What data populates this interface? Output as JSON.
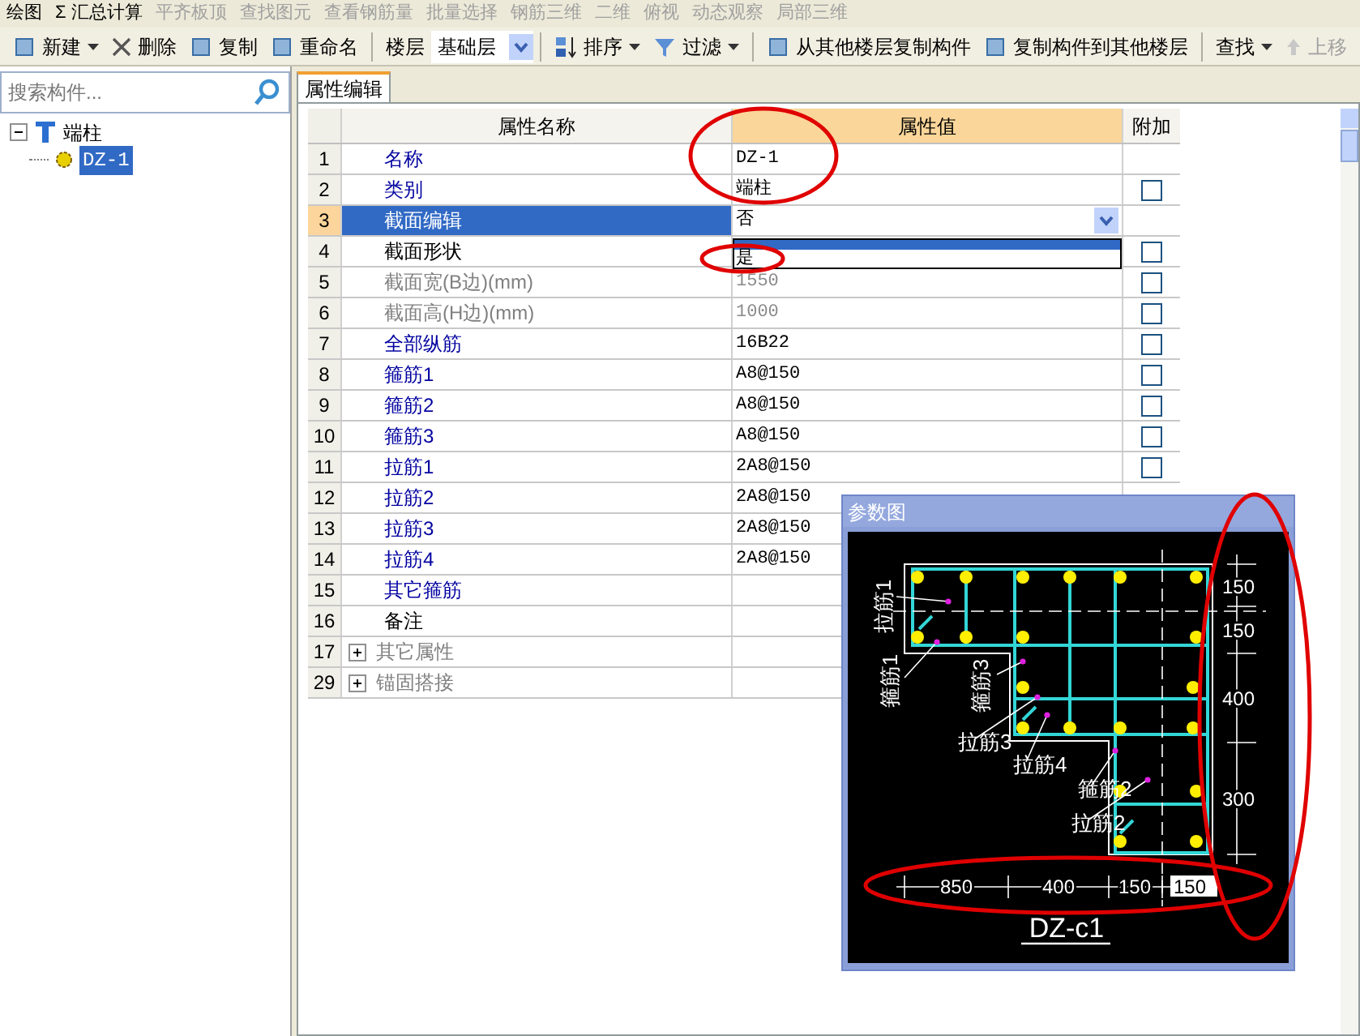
{
  "toolbar_top": [
    {
      "label": "绘图",
      "disabled": false
    },
    {
      "label": "Σ 汇总计算",
      "disabled": false
    },
    {
      "label": "平齐板顶",
      "disabled": true
    },
    {
      "label": "查找图元",
      "disabled": true
    },
    {
      "label": "查看钢筋量",
      "disabled": true
    },
    {
      "label": "批量选择",
      "disabled": true
    },
    {
      "label": "钢筋三维",
      "disabled": true
    },
    {
      "label": "二维",
      "disabled": true
    },
    {
      "label": "俯视",
      "disabled": true
    },
    {
      "label": "动态观察",
      "disabled": true
    },
    {
      "label": "局部三维",
      "disabled": true
    }
  ],
  "toolbar": {
    "new": "新建",
    "delete": "删除",
    "copy": "复制",
    "rename": "重命名",
    "floor_label": "楼层",
    "floor_value": "基础层",
    "sort": "排序",
    "filter": "过滤",
    "copy_from": "从其他楼层复制构件",
    "copy_to": "复制构件到其他楼层",
    "find": "查找",
    "move_up": "上移"
  },
  "search": {
    "placeholder": "搜索构件..."
  },
  "tree": [
    {
      "label": "端柱",
      "expanded": true,
      "selected": false,
      "children": [
        {
          "label": "DZ-1",
          "selected": true
        }
      ]
    }
  ],
  "tab": {
    "label": "属性编辑",
    "selected": true
  },
  "table": {
    "columns": [
      "属性名称",
      "属性值",
      "附加"
    ],
    "rows": [
      {
        "num": "1",
        "name": "名称",
        "value": "DZ-1",
        "kind": "link",
        "selected": false
      },
      {
        "num": "2",
        "name": "类别",
        "value": "端柱",
        "kind": "link",
        "checked": false,
        "selected": false
      },
      {
        "num": "3",
        "name": "截面编辑",
        "value": "否",
        "kind": "link",
        "selected": true
      },
      {
        "num": "4",
        "name": "截面形状",
        "kind": "plain",
        "checked": false,
        "selected": false
      },
      {
        "num": "5",
        "name": "截面宽(B边)(mm)",
        "value": "1550",
        "kind": "disabled",
        "checked": false,
        "selected": false
      },
      {
        "num": "6",
        "name": "截面高(H边)(mm)",
        "value": "1000",
        "kind": "disabled",
        "checked": false,
        "selected": false
      },
      {
        "num": "7",
        "name": "全部纵筋",
        "value": "16B22",
        "kind": "link",
        "checked": false,
        "selected": false
      },
      {
        "num": "8",
        "name": "箍筋1",
        "value": "A8@150",
        "kind": "link",
        "checked": false,
        "selected": false
      },
      {
        "num": "9",
        "name": "箍筋2",
        "value": "A8@150",
        "kind": "link",
        "checked": false,
        "selected": false
      },
      {
        "num": "10",
        "name": "箍筋3",
        "value": "A8@150",
        "kind": "link",
        "checked": false,
        "selected": false
      },
      {
        "num": "11",
        "name": "拉筋1",
        "value": "2A8@150",
        "kind": "link",
        "checked": false,
        "selected": false
      },
      {
        "num": "12",
        "name": "拉筋2",
        "value": "2A8@150",
        "kind": "link",
        "selected": false
      },
      {
        "num": "13",
        "name": "拉筋3",
        "value": "2A8@150",
        "kind": "link",
        "selected": false
      },
      {
        "num": "14",
        "name": "拉筋4",
        "value": "2A8@150",
        "kind": "link",
        "selected": false
      },
      {
        "num": "15",
        "name": "其它箍筋",
        "kind": "link",
        "selected": false
      },
      {
        "num": "16",
        "name": "备注",
        "kind": "plain",
        "selected": false
      },
      {
        "num": "17",
        "name": "其它属性",
        "kind": "group",
        "expanded": false,
        "selected": false
      },
      {
        "num": "29",
        "name": "锚固搭接",
        "kind": "group",
        "expanded": false,
        "selected": false
      }
    ]
  },
  "dropdown": {
    "options": [
      {
        "selected": true
      },
      {
        "label": "是",
        "selected": false
      }
    ]
  },
  "diagram": {
    "title": "参数图",
    "labels": [
      "拉筋1",
      "箍筋1",
      "箍筋3",
      "拉筋3",
      "拉筋4",
      "箍筋2",
      "拉筋2"
    ],
    "right_dims": [
      "150",
      "150",
      "400",
      "300"
    ],
    "bottom_dims": [
      "850",
      "400",
      "150"
    ],
    "input_value": "150",
    "name": "DZ-c1"
  }
}
